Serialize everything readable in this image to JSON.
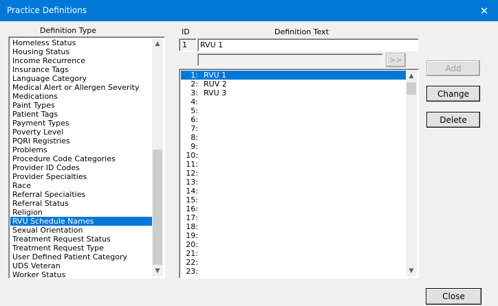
{
  "window": {
    "title": "Practice Definitions",
    "close_glyph": "✕"
  },
  "labels": {
    "definition_type": "Definition Type",
    "id": "ID",
    "definition_text": "Definition Text"
  },
  "definition_types": {
    "items": [
      "Homeless Status",
      "Housing Status",
      "Income Recurrence",
      "Insurance Tags",
      "Language Category",
      "Medical Alert or Allergen Severity",
      "Medications",
      "Paint Types",
      "Patient Tags",
      "Payment Types",
      "Poverty Level",
      "PQRI Registries",
      "Problems",
      "Procedure Code Categories",
      "Provider ID Codes",
      "Provider Specialties",
      "Race",
      "Referral Specialties",
      "Referral Status",
      "Religion",
      "RVU Schedule Names",
      "Sexual Orientation",
      "Treatment Request Status",
      "Treatment Request Type",
      "User Defined Patient Category",
      "UDS Veteran",
      "Worker Status"
    ],
    "selected": "RVU Schedule Names"
  },
  "edit": {
    "id_value": "1",
    "text_value": "RVU 1",
    "secondary_value": "",
    "move_label": ">>"
  },
  "definitions": {
    "rows": [
      {
        "num": "1:",
        "text": "RVU 1"
      },
      {
        "num": "2:",
        "text": "RUV 2"
      },
      {
        "num": "3:",
        "text": "RVU 3"
      },
      {
        "num": "4:",
        "text": ""
      },
      {
        "num": "5:",
        "text": ""
      },
      {
        "num": "6:",
        "text": ""
      },
      {
        "num": "7:",
        "text": ""
      },
      {
        "num": "8:",
        "text": ""
      },
      {
        "num": "9:",
        "text": ""
      },
      {
        "num": "10:",
        "text": ""
      },
      {
        "num": "11:",
        "text": ""
      },
      {
        "num": "12:",
        "text": ""
      },
      {
        "num": "13:",
        "text": ""
      },
      {
        "num": "14:",
        "text": ""
      },
      {
        "num": "15:",
        "text": ""
      },
      {
        "num": "16:",
        "text": ""
      },
      {
        "num": "17:",
        "text": ""
      },
      {
        "num": "18:",
        "text": ""
      },
      {
        "num": "19:",
        "text": ""
      },
      {
        "num": "20:",
        "text": ""
      },
      {
        "num": "21:",
        "text": ""
      },
      {
        "num": "22:",
        "text": ""
      },
      {
        "num": "23:",
        "text": ""
      }
    ],
    "selected_num": "1:"
  },
  "buttons": {
    "add": "Add",
    "change": "Change",
    "delete": "Delete",
    "close": "Close"
  },
  "icons": {
    "scroll_up": "chevron-up-icon",
    "scroll_down": "chevron-down-icon"
  },
  "colors": {
    "accent": "#0078d7",
    "window_bg": "#f0f0f0"
  }
}
